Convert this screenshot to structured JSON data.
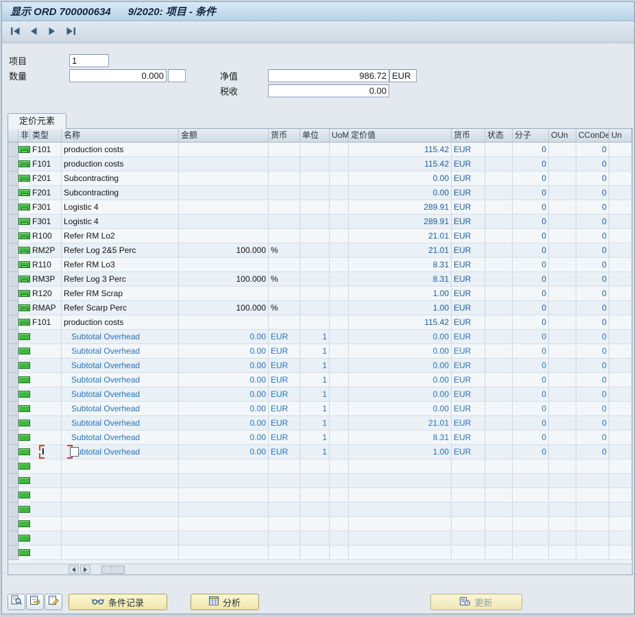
{
  "window": {
    "title": "显示 ORD 700000634      9/2020: 项目 - 条件"
  },
  "form": {
    "item": {
      "label": "项目",
      "value": "1"
    },
    "quantity": {
      "label": "数量",
      "value": "0.000",
      "unit": ""
    },
    "net_value": {
      "label": "净值",
      "value": "986.72",
      "currency": "EUR"
    },
    "tax": {
      "label": "税收",
      "value": "0.00"
    }
  },
  "tabs": {
    "pricing_elements": "定价元素"
  },
  "table": {
    "headers": [
      "非.",
      "类型",
      "名称",
      "金额",
      "货币",
      "单位",
      "UoM",
      "定价值",
      "货币",
      "状态",
      "分子",
      "OUn",
      "CConDe",
      "Un"
    ],
    "rows": [
      {
        "led": true,
        "type": "F101",
        "name": "production costs",
        "value": "115.42",
        "curr": "EUR",
        "num": "0",
        "cconde": "0"
      },
      {
        "led": true,
        "type": "F101",
        "name": "production costs",
        "value": "115.42",
        "curr": "EUR",
        "num": "0",
        "cconde": "0"
      },
      {
        "led": true,
        "type": "F201",
        "name": "Subcontracting",
        "value": "0.00",
        "curr": "EUR",
        "num": "0",
        "cconde": "0"
      },
      {
        "led": true,
        "type": "F201",
        "name": "Subcontracting",
        "value": "0.00",
        "curr": "EUR",
        "num": "0",
        "cconde": "0"
      },
      {
        "led": true,
        "type": "F301",
        "name": "Logistic 4",
        "value": "289.91",
        "curr": "EUR",
        "num": "0",
        "cconde": "0"
      },
      {
        "led": true,
        "type": "F301",
        "name": "Logistic 4",
        "value": "289.91",
        "curr": "EUR",
        "num": "0",
        "cconde": "0"
      },
      {
        "led": true,
        "type": "R100",
        "name": "Refer RM Lo2",
        "value": "21.01",
        "curr": "EUR",
        "num": "0",
        "cconde": "0"
      },
      {
        "led": true,
        "type": "RM2P",
        "name": "Refer Log 2&5 Perc",
        "amount": "100.000",
        "crcy": "%",
        "value": "21.01",
        "curr": "EUR",
        "num": "0",
        "cconde": "0"
      },
      {
        "led": true,
        "type": "R110",
        "name": "Refer RM Lo3",
        "value": "8.31",
        "curr": "EUR",
        "num": "0",
        "cconde": "0"
      },
      {
        "led": true,
        "type": "RM3P",
        "name": "Refer Log 3 Perc",
        "amount": "100.000",
        "crcy": "%",
        "value": "8.31",
        "curr": "EUR",
        "num": "0",
        "cconde": "0"
      },
      {
        "led": true,
        "type": "R120",
        "name": "Refer RM Scrap",
        "value": "1.00",
        "curr": "EUR",
        "num": "0",
        "cconde": "0"
      },
      {
        "led": true,
        "type": "RMAP",
        "name": "Refer Scarp Perc",
        "amount": "100.000",
        "crcy": "%",
        "value": "1.00",
        "curr": "EUR",
        "num": "0",
        "cconde": "0"
      },
      {
        "led": true,
        "type": "F101",
        "name": "production costs",
        "value": "115.42",
        "curr": "EUR",
        "num": "0",
        "cconde": "0"
      },
      {
        "subtotal": true,
        "name": "Subtotal Overhead",
        "amount": "0.00",
        "crcy": "EUR",
        "per": "1",
        "value": "0.00",
        "curr": "EUR",
        "num": "0",
        "cconde": "0"
      },
      {
        "subtotal": true,
        "name": "Subtotal Overhead",
        "amount": "0.00",
        "crcy": "EUR",
        "per": "1",
        "value": "0.00",
        "curr": "EUR",
        "num": "0",
        "cconde": "0"
      },
      {
        "subtotal": true,
        "name": "Subtotal Overhead",
        "amount": "0.00",
        "crcy": "EUR",
        "per": "1",
        "value": "0.00",
        "curr": "EUR",
        "num": "0",
        "cconde": "0"
      },
      {
        "subtotal": true,
        "name": "Subtotal Overhead",
        "amount": "0.00",
        "crcy": "EUR",
        "per": "1",
        "value": "0.00",
        "curr": "EUR",
        "num": "0",
        "cconde": "0"
      },
      {
        "subtotal": true,
        "name": "Subtotal Overhead",
        "amount": "0.00",
        "crcy": "EUR",
        "per": "1",
        "value": "0.00",
        "curr": "EUR",
        "num": "0",
        "cconde": "0"
      },
      {
        "subtotal": true,
        "name": "Subtotal Overhead",
        "amount": "0.00",
        "crcy": "EUR",
        "per": "1",
        "value": "0.00",
        "curr": "EUR",
        "num": "0",
        "cconde": "0"
      },
      {
        "subtotal": true,
        "name": "Subtotal Overhead",
        "amount": "0.00",
        "crcy": "EUR",
        "per": "1",
        "value": "21.01",
        "curr": "EUR",
        "num": "0",
        "cconde": "0"
      },
      {
        "subtotal": true,
        "name": "Subtotal Overhead",
        "amount": "0.00",
        "crcy": "EUR",
        "per": "1",
        "value": "8.31",
        "curr": "EUR",
        "num": "0",
        "cconde": "0"
      },
      {
        "subtotal": true,
        "editing": true,
        "name": "Subtotal Overhead",
        "amount": "0.00",
        "crcy": "EUR",
        "per": "1",
        "value": "1.00",
        "curr": "EUR",
        "num": "0",
        "cconde": "0"
      }
    ]
  },
  "footer": {
    "condition_record": "条件记录",
    "analysis": "分析",
    "update": "更新"
  },
  "icons": {
    "nav_first": "first-page-icon",
    "nav_prev": "previous-page-icon",
    "nav_next": "next-page-icon",
    "nav_last": "last-page-icon",
    "row_status": "green-status-icon",
    "condition_detail": "magnifier-document-icon",
    "condition_copy": "document-arrow-icon",
    "condition_change": "document-pencil-icon",
    "condition_record": "glasses-icon",
    "analysis": "grid-calculator-icon",
    "update": "clipboard-clock-icon",
    "scroll_left": "scroll-left-icon",
    "scroll_right": "scroll-right-icon"
  },
  "colors": {
    "status_green": "#3db83d",
    "value_blue": "#1d5c9e",
    "subtotal_link_blue": "#2a72b8",
    "titlebar_blue": "#b7d2e8"
  }
}
